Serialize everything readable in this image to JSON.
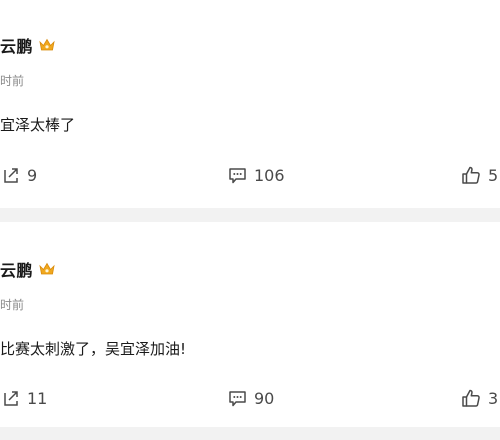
{
  "posts": [
    {
      "author": "云鹏",
      "time": "时前",
      "content": "宜泽太棒了",
      "share_count": "9",
      "comment_count": "106",
      "like_count": "5"
    },
    {
      "author": "云鹏",
      "time": "时前",
      "content": "比赛太刺激了，吴宜泽加油!",
      "share_count": "11",
      "comment_count": "90",
      "like_count": "3"
    }
  ],
  "colors": {
    "separator": "#f2f2f2",
    "crown": "#f0a81e",
    "muted_text": "#8a8a8a",
    "icon": "#4a4a4a"
  },
  "icons": [
    "crown-badge-icon",
    "share-icon",
    "comment-icon",
    "like-icon"
  ]
}
